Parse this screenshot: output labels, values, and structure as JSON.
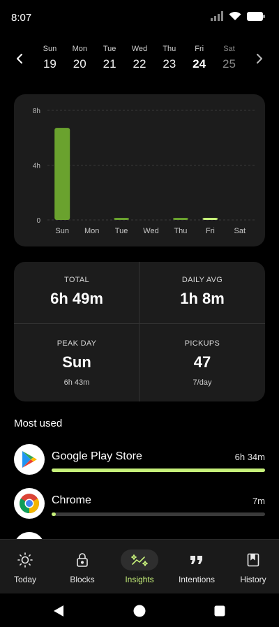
{
  "status_bar": {
    "time": "8:07"
  },
  "week": {
    "days": [
      {
        "name": "Sun",
        "num": "19"
      },
      {
        "name": "Mon",
        "num": "20"
      },
      {
        "name": "Tue",
        "num": "21"
      },
      {
        "name": "Wed",
        "num": "22"
      },
      {
        "name": "Thu",
        "num": "23"
      },
      {
        "name": "Fri",
        "num": "24"
      },
      {
        "name": "Sat",
        "num": "25"
      }
    ],
    "selected": "Fri",
    "future": [
      "Sat"
    ]
  },
  "chart_data": {
    "type": "bar",
    "categories": [
      "Sun",
      "Mon",
      "Tue",
      "Wed",
      "Thu",
      "Fri",
      "Sat"
    ],
    "values": [
      6.72,
      0,
      0.05,
      0,
      0.05,
      0.08,
      0
    ],
    "highlight": "Fri",
    "y_ticks": [
      "0",
      "4h",
      "8h"
    ],
    "ylim": [
      0,
      8
    ],
    "grid": true,
    "colors": {
      "bar": "#6aa22e",
      "highlight": "#c6f07a"
    }
  },
  "stats": {
    "total_label": "TOTAL",
    "total_value": "6h 49m",
    "avg_label": "DAILY AVG",
    "avg_value": "1h 8m",
    "peak_label": "PEAK DAY",
    "peak_value": "Sun",
    "peak_sub": "6h 43m",
    "pickups_label": "PICKUPS",
    "pickups_value": "47",
    "pickups_sub": "7/day"
  },
  "most_used": {
    "title": "Most used",
    "apps": [
      {
        "name": "Google Play Store",
        "time": "6h 34m",
        "fraction": 1.0,
        "icon": "google-play-icon"
      },
      {
        "name": "Chrome",
        "time": "7m",
        "fraction": 0.02,
        "icon": "chrome-icon"
      }
    ]
  },
  "bottom_nav": {
    "items": [
      {
        "label": "Today",
        "icon": "sun-icon"
      },
      {
        "label": "Blocks",
        "icon": "lock-icon"
      },
      {
        "label": "Insights",
        "icon": "insights-sparkle-icon"
      },
      {
        "label": "Intentions",
        "icon": "quote-icon"
      },
      {
        "label": "History",
        "icon": "bookmark-book-icon"
      }
    ],
    "active": "Insights"
  },
  "colors": {
    "accent": "#c6f07a",
    "card": "#1c1c1c",
    "background": "#000000"
  }
}
